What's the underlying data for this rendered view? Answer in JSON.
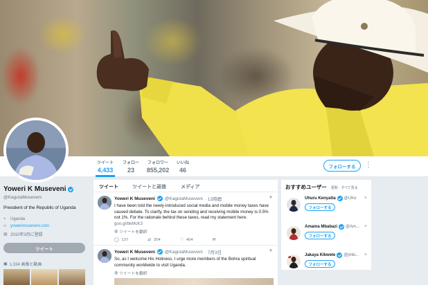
{
  "colors": {
    "accent": "#1da1f2",
    "muted": "#657786",
    "shirt": "#f0e04a"
  },
  "profile": {
    "name": "Yoweri K Museveni",
    "handle": "@KagutaMuseveni",
    "bio": "President of the Republic of Uganda",
    "location": "Uganda",
    "url": "yowerimuseveni.com",
    "joined": "2010年3月に登録",
    "tweet_to_label": "ツイート",
    "photos_label": "1,334 画像と動画"
  },
  "nav": {
    "stats": [
      {
        "label": "ツイート",
        "value": "4,433"
      },
      {
        "label": "フォロー",
        "value": "23"
      },
      {
        "label": "フォロワー",
        "value": "855,202"
      },
      {
        "label": "いいね",
        "value": "46"
      }
    ],
    "follow_label": "フォローする",
    "more_icon": "more-vertical-icon"
  },
  "timeline": {
    "tabs": [
      "ツイート",
      "ツイートと返信",
      "メディア"
    ],
    "tweets": [
      {
        "name": "Yoweri K Museveni",
        "handle": "@KagutaMuseveni",
        "time": "· 12時間",
        "text": "I have been told the newly-introduced social media and mobile money taxes have caused debate. To clarify, the tax on sending and receiving mobile money is 0.5% not 1%. For the rationale behind these taxes, read my statement here:",
        "link": "goo.gl/bkMcK3",
        "translate": "ツイートを翻訳",
        "replies": "137",
        "retweets": "204",
        "likes": "404"
      },
      {
        "name": "Yoweri K Museveni",
        "handle": "@KagutaMuseveni",
        "time": "· 7月3日",
        "text": "So, as I welcome His Holiness, I urge more members of the Bohra spiritual community worldwide to visit Uganda.",
        "translate": "ツイートを翻訳"
      }
    ]
  },
  "who_to_follow": {
    "title": "おすすめユーザー",
    "refresh": "· 更新 · すべて見る",
    "follow_label": "フォローする",
    "users": [
      {
        "name": "Uhuru Kenyatta",
        "handle": "@UKe"
      },
      {
        "name": "Amama Mbabazi",
        "handle": "@Am..."
      },
      {
        "name": "Jakaya Kikwete",
        "handle": "@jmki..."
      }
    ]
  }
}
